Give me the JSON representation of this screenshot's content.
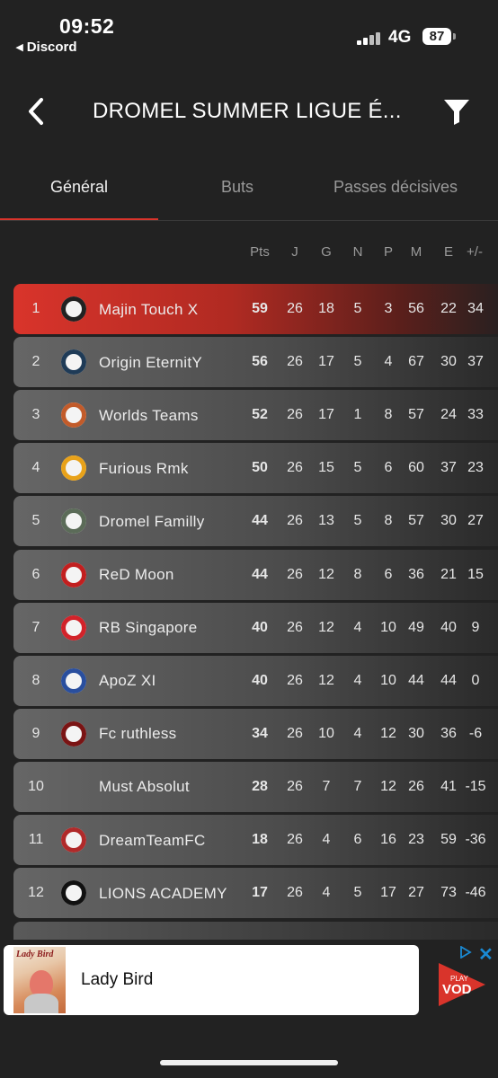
{
  "status_bar": {
    "time": "09:52",
    "back_app": "◂ Discord",
    "network": "4G",
    "battery": "87"
  },
  "header": {
    "title": "DROMEL SUMMER LIGUE É..."
  },
  "tabs": [
    {
      "label": "Général",
      "active": true
    },
    {
      "label": "Buts",
      "active": false
    },
    {
      "label": "Passes décisives",
      "active": false
    }
  ],
  "columns": [
    "Pts",
    "J",
    "G",
    "N",
    "P",
    "M",
    "E",
    "+/-"
  ],
  "standings": [
    {
      "rank": "1",
      "team": "Majin Touch X",
      "pts": "59",
      "j": "26",
      "g": "18",
      "n": "5",
      "p": "3",
      "m": "56",
      "e": "22",
      "diff": "34",
      "logo_icon": "majin-logo-icon",
      "logo_color": "#222222"
    },
    {
      "rank": "2",
      "team": "Origin EternitY",
      "pts": "56",
      "j": "26",
      "g": "17",
      "n": "5",
      "p": "4",
      "m": "67",
      "e": "30",
      "diff": "37",
      "logo_icon": "infinity-logo-icon",
      "logo_color": "#1f3b57"
    },
    {
      "rank": "3",
      "team": "Worlds Teams",
      "pts": "52",
      "j": "26",
      "g": "17",
      "n": "1",
      "p": "8",
      "m": "57",
      "e": "24",
      "diff": "33",
      "logo_icon": "worlds-logo-icon",
      "logo_color": "#c25b2a"
    },
    {
      "rank": "4",
      "team": "Furious Rmk",
      "pts": "50",
      "j": "26",
      "g": "15",
      "n": "5",
      "p": "6",
      "m": "60",
      "e": "37",
      "diff": "23",
      "logo_icon": "furious-logo-icon",
      "logo_color": "#e8a21a"
    },
    {
      "rank": "5",
      "team": "Dromel Familly",
      "pts": "44",
      "j": "26",
      "g": "13",
      "n": "5",
      "p": "8",
      "m": "57",
      "e": "30",
      "diff": "27",
      "logo_icon": "dromel-logo-icon",
      "logo_color": "#5b6b58"
    },
    {
      "rank": "6",
      "team": "ReD Moon",
      "pts": "44",
      "j": "26",
      "g": "12",
      "n": "8",
      "p": "6",
      "m": "36",
      "e": "21",
      "diff": "15",
      "logo_icon": "red-moon-logo-icon",
      "logo_color": "#c21f1f"
    },
    {
      "rank": "7",
      "team": "RB Singapore",
      "pts": "40",
      "j": "26",
      "g": "12",
      "n": "4",
      "p": "10",
      "m": "49",
      "e": "40",
      "diff": "9",
      "logo_icon": "rb-logo-icon",
      "logo_color": "#d2232a"
    },
    {
      "rank": "8",
      "team": "ApoZ XI",
      "pts": "40",
      "j": "26",
      "g": "12",
      "n": "4",
      "p": "10",
      "m": "44",
      "e": "44",
      "diff": "0",
      "logo_icon": "apoz-logo-icon",
      "logo_color": "#2a4f9e"
    },
    {
      "rank": "9",
      "team": "Fc ruthless",
      "pts": "34",
      "j": "26",
      "g": "10",
      "n": "4",
      "p": "12",
      "m": "30",
      "e": "36",
      "diff": "-6",
      "logo_icon": "ruthless-logo-icon",
      "logo_color": "#7a1414"
    },
    {
      "rank": "10",
      "team": "Must Absolut",
      "pts": "28",
      "j": "26",
      "g": "7",
      "n": "7",
      "p": "12",
      "m": "26",
      "e": "41",
      "diff": "-15",
      "logo_icon": "",
      "logo_color": ""
    },
    {
      "rank": "11",
      "team": "DreamTeamFC",
      "pts": "18",
      "j": "26",
      "g": "4",
      "n": "6",
      "p": "16",
      "m": "23",
      "e": "59",
      "diff": "-36",
      "logo_icon": "dreamteam-logo-icon",
      "logo_color": "#b02a2a"
    },
    {
      "rank": "12",
      "team": "LIONS ACADEMY",
      "pts": "17",
      "j": "26",
      "g": "4",
      "n": "5",
      "p": "17",
      "m": "27",
      "e": "73",
      "diff": "-46",
      "logo_icon": "lions-logo-icon",
      "logo_color": "#111111"
    }
  ],
  "ad": {
    "poster_text": "Lady Bird",
    "title": "Lady Bird",
    "logo_top": "PLAY",
    "logo_bottom": "VOD"
  },
  "colors": {
    "accent": "#d9342b",
    "background": "#222222"
  }
}
